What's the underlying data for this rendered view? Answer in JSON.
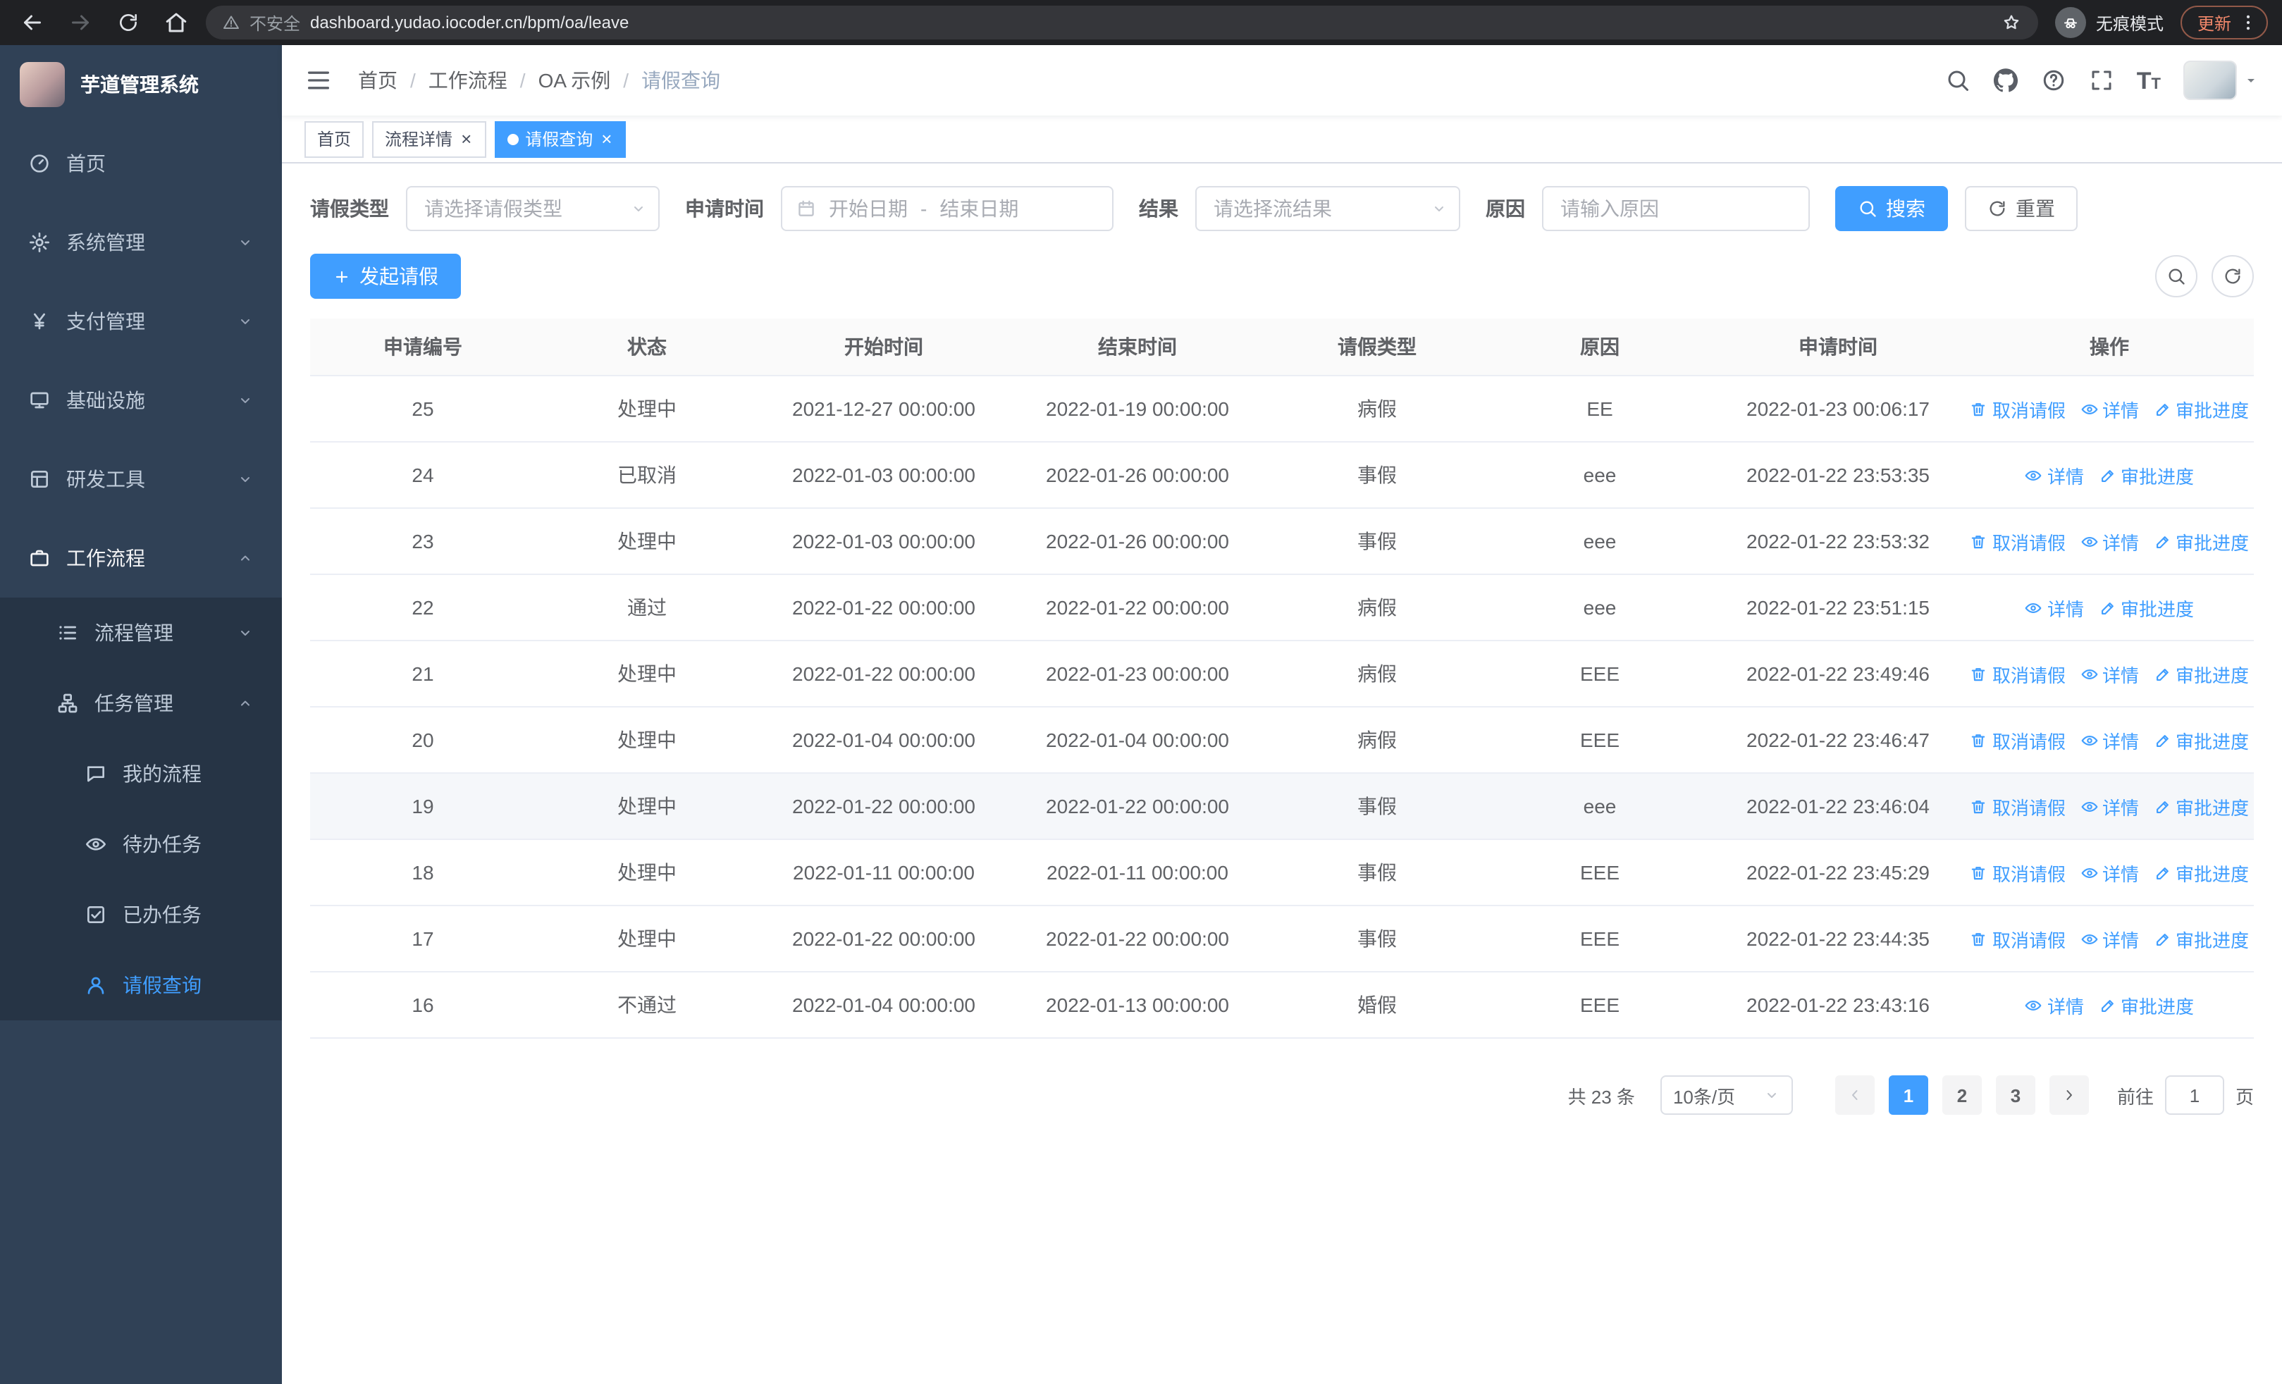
{
  "browser": {
    "security_label": "不安全",
    "url": "dashboard.yudao.iocoder.cn/bpm/oa/leave",
    "incognito_label": "无痕模式",
    "update_label": "更新"
  },
  "app": {
    "title": "芋道管理系统"
  },
  "sidebar": {
    "items": [
      {
        "label": "首页"
      },
      {
        "label": "系统管理"
      },
      {
        "label": "支付管理"
      },
      {
        "label": "基础设施"
      },
      {
        "label": "研发工具"
      },
      {
        "label": "工作流程"
      }
    ],
    "submenu": [
      {
        "label": "流程管理"
      },
      {
        "label": "任务管理"
      }
    ],
    "leaves": [
      {
        "label": "我的流程"
      },
      {
        "label": "待办任务"
      },
      {
        "label": "已办任务"
      },
      {
        "label": "请假查询"
      }
    ]
  },
  "breadcrumb": [
    "首页",
    "工作流程",
    "OA 示例",
    "请假查询"
  ],
  "tabs": [
    {
      "label": "首页"
    },
    {
      "label": "流程详情"
    },
    {
      "label": "请假查询"
    }
  ],
  "filters": {
    "leave_type_label": "请假类型",
    "leave_type_placeholder": "请选择请假类型",
    "apply_time_label": "申请时间",
    "start_date_placeholder": "开始日期",
    "range_separator": "-",
    "end_date_placeholder": "结束日期",
    "result_label": "结果",
    "result_placeholder": "请选择流结果",
    "reason_label": "原因",
    "reason_placeholder": "请输入原因",
    "search_button": "搜索",
    "reset_button": "重置"
  },
  "toolbar": {
    "create_button": "发起请假"
  },
  "table": {
    "columns": [
      "申请编号",
      "状态",
      "开始时间",
      "结束时间",
      "请假类型",
      "原因",
      "申请时间",
      "操作"
    ],
    "rows": [
      {
        "id": "25",
        "status": "处理中",
        "start": "2021-12-27 00:00:00",
        "end": "2022-01-19 00:00:00",
        "type": "病假",
        "reason": "EE",
        "apply_time": "2022-01-23 00:06:17",
        "highlight": false,
        "actions": [
          "取消请假",
          "详情",
          "审批进度"
        ]
      },
      {
        "id": "24",
        "status": "已取消",
        "start": "2022-01-03 00:00:00",
        "end": "2022-01-26 00:00:00",
        "type": "事假",
        "reason": "eee",
        "apply_time": "2022-01-22 23:53:35",
        "highlight": false,
        "actions": [
          "详情",
          "审批进度"
        ]
      },
      {
        "id": "23",
        "status": "处理中",
        "start": "2022-01-03 00:00:00",
        "end": "2022-01-26 00:00:00",
        "type": "事假",
        "reason": "eee",
        "apply_time": "2022-01-22 23:53:32",
        "highlight": false,
        "actions": [
          "取消请假",
          "详情",
          "审批进度"
        ]
      },
      {
        "id": "22",
        "status": "通过",
        "start": "2022-01-22 00:00:00",
        "end": "2022-01-22 00:00:00",
        "type": "病假",
        "reason": "eee",
        "apply_time": "2022-01-22 23:51:15",
        "highlight": false,
        "actions": [
          "详情",
          "审批进度"
        ]
      },
      {
        "id": "21",
        "status": "处理中",
        "start": "2022-01-22 00:00:00",
        "end": "2022-01-23 00:00:00",
        "type": "病假",
        "reason": "EEE",
        "apply_time": "2022-01-22 23:49:46",
        "highlight": false,
        "actions": [
          "取消请假",
          "详情",
          "审批进度"
        ]
      },
      {
        "id": "20",
        "status": "处理中",
        "start": "2022-01-04 00:00:00",
        "end": "2022-01-04 00:00:00",
        "type": "病假",
        "reason": "EEE",
        "apply_time": "2022-01-22 23:46:47",
        "highlight": false,
        "actions": [
          "取消请假",
          "详情",
          "审批进度"
        ]
      },
      {
        "id": "19",
        "status": "处理中",
        "start": "2022-01-22 00:00:00",
        "end": "2022-01-22 00:00:00",
        "type": "事假",
        "reason": "eee",
        "apply_time": "2022-01-22 23:46:04",
        "highlight": true,
        "actions": [
          "取消请假",
          "详情",
          "审批进度"
        ]
      },
      {
        "id": "18",
        "status": "处理中",
        "start": "2022-01-11 00:00:00",
        "end": "2022-01-11 00:00:00",
        "type": "事假",
        "reason": "EEE",
        "apply_time": "2022-01-22 23:45:29",
        "highlight": false,
        "actions": [
          "取消请假",
          "详情",
          "审批进度"
        ]
      },
      {
        "id": "17",
        "status": "处理中",
        "start": "2022-01-22 00:00:00",
        "end": "2022-01-22 00:00:00",
        "type": "事假",
        "reason": "EEE",
        "apply_time": "2022-01-22 23:44:35",
        "highlight": false,
        "actions": [
          "取消请假",
          "详情",
          "审批进度"
        ]
      },
      {
        "id": "16",
        "status": "不通过",
        "start": "2022-01-04 00:00:00",
        "end": "2022-01-13 00:00:00",
        "type": "婚假",
        "reason": "EEE",
        "apply_time": "2022-01-22 23:43:16",
        "highlight": false,
        "actions": [
          "详情",
          "审批进度"
        ]
      }
    ]
  },
  "pagination": {
    "total_text": "共 23 条",
    "page_size": "10条/页",
    "pages": [
      "1",
      "2",
      "3"
    ],
    "active_page": "1",
    "goto_label": "前往",
    "goto_value": "1",
    "goto_suffix": "页"
  },
  "colors": {
    "primary": "#409eff",
    "sidebar_bg": "#304156",
    "submenu_bg": "#263445",
    "chrome_bg": "#202124",
    "update_accent": "#f0876a"
  }
}
